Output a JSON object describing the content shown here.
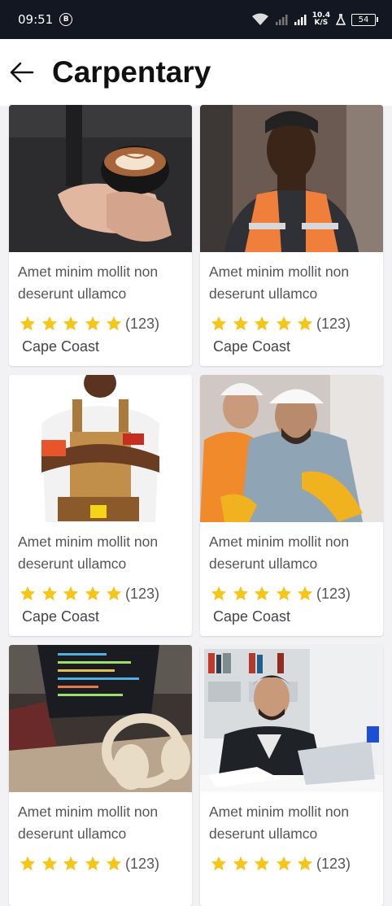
{
  "status_bar": {
    "time": "09:51",
    "notification_badge": "B",
    "speed_value": "10.4",
    "speed_unit": "K/S",
    "battery": "54"
  },
  "app_bar": {
    "title": "Carpentary",
    "back_icon": "arrow-left-icon"
  },
  "colors": {
    "star": "#f5c518",
    "title": "#111111",
    "body_text": "#555555",
    "background": "#f2f2f4"
  },
  "cards": [
    {
      "title": "Amet minim mollit non deserunt ullamco",
      "rating_count": "(123)",
      "location": "Cape Coast",
      "image": "barista-holding-coffee-cup"
    },
    {
      "title": "Amet minim mollit non deserunt ullamco",
      "rating_count": "(123)",
      "location": "Cape Coast",
      "image": "worker-in-safety-vest"
    },
    {
      "title": "Amet minim mollit non deserunt ullamco",
      "rating_count": "(123)",
      "location": "Cape Coast",
      "image": "carpenter-with-tool-belt"
    },
    {
      "title": "Amet minim mollit non deserunt ullamco",
      "rating_count": "(123)",
      "location": "Cape Coast",
      "image": "engineers-with-hard-hats"
    },
    {
      "title": "Amet minim mollit non deserunt ullamco",
      "rating_count": "(123)",
      "location": "",
      "image": "laptop-and-headphones"
    },
    {
      "title": "Amet minim mollit non deserunt ullamco",
      "rating_count": "(123)",
      "location": "",
      "image": "man-studying-at-desk"
    }
  ]
}
